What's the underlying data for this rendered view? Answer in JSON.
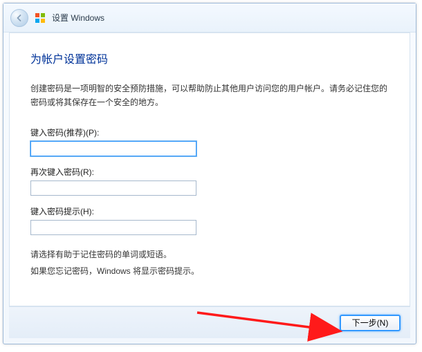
{
  "titlebar": {
    "title": "设置 Windows"
  },
  "page": {
    "heading": "为帐户设置密码",
    "description": "创建密码是一项明智的安全预防措施，可以帮助防止其他用户访问您的用户帐户。请务必记住您的密码或将其保存在一个安全的地方。",
    "password_label": "键入密码(推荐)(P):",
    "confirm_label": "再次键入密码(R):",
    "hint_label": "键入密码提示(H):",
    "password_value": "",
    "confirm_value": "",
    "hint_value": "",
    "hint_text_line1": "请选择有助于记住密码的单词或短语。",
    "hint_text_line2": "如果您忘记密码，Windows 将显示密码提示。"
  },
  "footer": {
    "next_label": "下一步(N)"
  }
}
